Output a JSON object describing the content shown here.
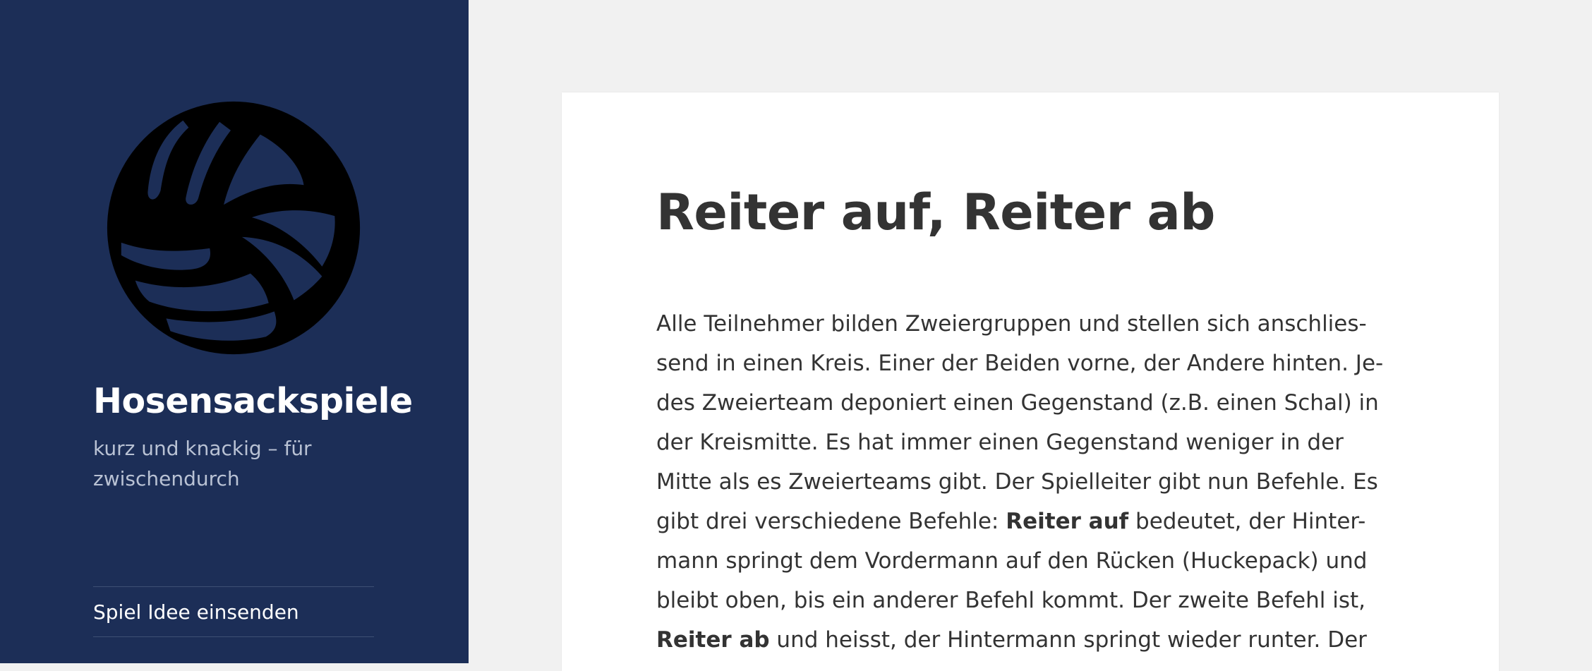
{
  "site": {
    "title": "Hosensackspiele",
    "description": "kurz und knackig – für zwischendurch",
    "logo_icon": "volleyball-icon"
  },
  "nav": {
    "items": [
      {
        "label": "Spiel Idee einsenden"
      }
    ]
  },
  "post": {
    "title": "Reiter auf, Reiter ab",
    "lines": [
      {
        "before": "Alle Teilnehmer bilden Zweiergruppen und stellen sich anschlies-",
        "bold": "",
        "after": ""
      },
      {
        "before": "send in einen Kreis. Einer der Beiden vorne, der Andere hinten. Je-",
        "bold": "",
        "after": ""
      },
      {
        "before": "des Zweierteam deponiert einen Gegenstand (z.B. einen Schal) in",
        "bold": "",
        "after": ""
      },
      {
        "before": "der Kreismitte. Es hat immer einen Gegenstand weniger in der",
        "bold": "",
        "after": ""
      },
      {
        "before": "Mitte als es Zweierteams gibt. Der Spielleiter gibt nun Befehle. Es",
        "bold": "",
        "after": ""
      },
      {
        "before": "gibt drei verschiedene Befehle: ",
        "bold": "Reiter auf",
        "after": " bedeutet, der Hinter-"
      },
      {
        "before": "mann springt dem Vordermann auf den Rücken (Huckepack) und",
        "bold": "",
        "after": ""
      },
      {
        "before": "bleibt oben, bis ein anderer Befehl kommt. Der zweite Befehl ist,",
        "bold": "",
        "after": ""
      },
      {
        "before": "",
        "bold": "Reiter ab",
        "after": " und heisst, der Hintermann springt wieder runter. Der"
      }
    ]
  },
  "colors": {
    "sidebar_bg": "#1c2e57",
    "page_bg": "#f1f1f1",
    "card_bg": "#ffffff",
    "text": "#333333"
  }
}
